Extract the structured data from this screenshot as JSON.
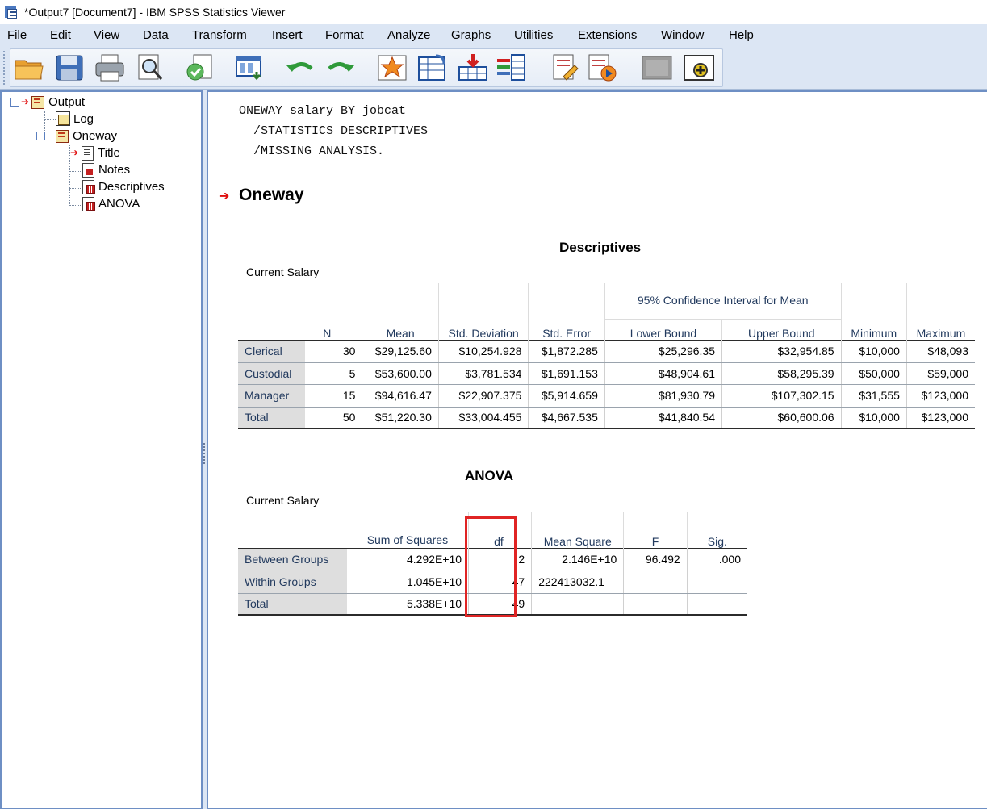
{
  "window": {
    "title": "*Output7 [Document7] - IBM SPSS Statistics Viewer"
  },
  "menu": {
    "items": [
      {
        "label": "File",
        "accel": "F"
      },
      {
        "label": "Edit",
        "accel": "E"
      },
      {
        "label": "View",
        "accel": "V"
      },
      {
        "label": "Data",
        "accel": "D"
      },
      {
        "label": "Transform",
        "accel": "T"
      },
      {
        "label": "Insert",
        "accel": "I"
      },
      {
        "label": "Format",
        "accel": "o"
      },
      {
        "label": "Analyze",
        "accel": "A"
      },
      {
        "label": "Graphs",
        "accel": "G"
      },
      {
        "label": "Utilities",
        "accel": "U"
      },
      {
        "label": "Extensions",
        "accel": "x"
      },
      {
        "label": "Window",
        "accel": "W"
      },
      {
        "label": "Help",
        "accel": "H"
      }
    ]
  },
  "toolbar": {
    "buttons": [
      {
        "icon": "open-folder-icon"
      },
      {
        "icon": "save-icon"
      },
      {
        "icon": "print-icon"
      },
      {
        "icon": "print-preview-icon"
      },
      {
        "icon": "export-icon"
      },
      {
        "icon": "recall-dialog-icon"
      },
      {
        "icon": "undo-icon"
      },
      {
        "icon": "redo-icon"
      },
      {
        "icon": "go-to-data-icon"
      },
      {
        "icon": "go-to-case-icon"
      },
      {
        "icon": "insert-variable-icon"
      },
      {
        "icon": "variables-icon"
      },
      {
        "icon": "create-script-icon"
      },
      {
        "icon": "run-script-icon"
      },
      {
        "icon": "designate-window-icon"
      },
      {
        "icon": "add-icon"
      }
    ]
  },
  "outline": {
    "root": "Output",
    "log": "Log",
    "procedure": "Oneway",
    "children": [
      "Title",
      "Notes",
      "Descriptives",
      "ANOVA"
    ]
  },
  "syntax": {
    "lines": [
      "ONEWAY salary BY jobcat",
      "  /STATISTICS DESCRIPTIVES",
      "  /MISSING ANALYSIS."
    ]
  },
  "heading": "Oneway",
  "descriptives": {
    "title": "Descriptives",
    "caption": "Current Salary",
    "ci_header": "95% Confidence Interval for Mean",
    "columns": [
      "N",
      "Mean",
      "Std. Deviation",
      "Std. Error",
      "Lower Bound",
      "Upper Bound",
      "Minimum",
      "Maximum"
    ],
    "rows": [
      {
        "label": "Clerical",
        "values": [
          "30",
          "$29,125.60",
          "$10,254.928",
          "$1,872.285",
          "$25,296.35",
          "$32,954.85",
          "$10,000",
          "$48,093"
        ]
      },
      {
        "label": "Custodial",
        "values": [
          "5",
          "$53,600.00",
          "$3,781.534",
          "$1,691.153",
          "$48,904.61",
          "$58,295.39",
          "$50,000",
          "$59,000"
        ]
      },
      {
        "label": "Manager",
        "values": [
          "15",
          "$94,616.47",
          "$22,907.375",
          "$5,914.659",
          "$81,930.79",
          "$107,302.15",
          "$31,555",
          "$123,000"
        ]
      },
      {
        "label": "Total",
        "values": [
          "50",
          "$51,220.30",
          "$33,004.455",
          "$4,667.535",
          "$41,840.54",
          "$60,600.06",
          "$10,000",
          "$123,000"
        ]
      }
    ]
  },
  "anova": {
    "title": "ANOVA",
    "caption": "Current Salary",
    "columns": [
      "Sum of Squares",
      "df",
      "Mean Square",
      "F",
      "Sig."
    ],
    "rows": [
      {
        "label": "Between Groups",
        "values": [
          "4.292E+10",
          "2",
          "2.146E+10",
          "96.492",
          ".000"
        ]
      },
      {
        "label": "Within Groups",
        "values": [
          "1.045E+10",
          "47",
          "222413032.1",
          "",
          ""
        ]
      },
      {
        "label": "Total",
        "values": [
          "5.338E+10",
          "49",
          "",
          "",
          ""
        ]
      }
    ]
  },
  "colors": {
    "accent": "#dce6f4",
    "pane_border": "#6e8fc4",
    "highlight": "#e02424",
    "row_label_bg": "#dedede",
    "label_text": "#223a5e"
  }
}
